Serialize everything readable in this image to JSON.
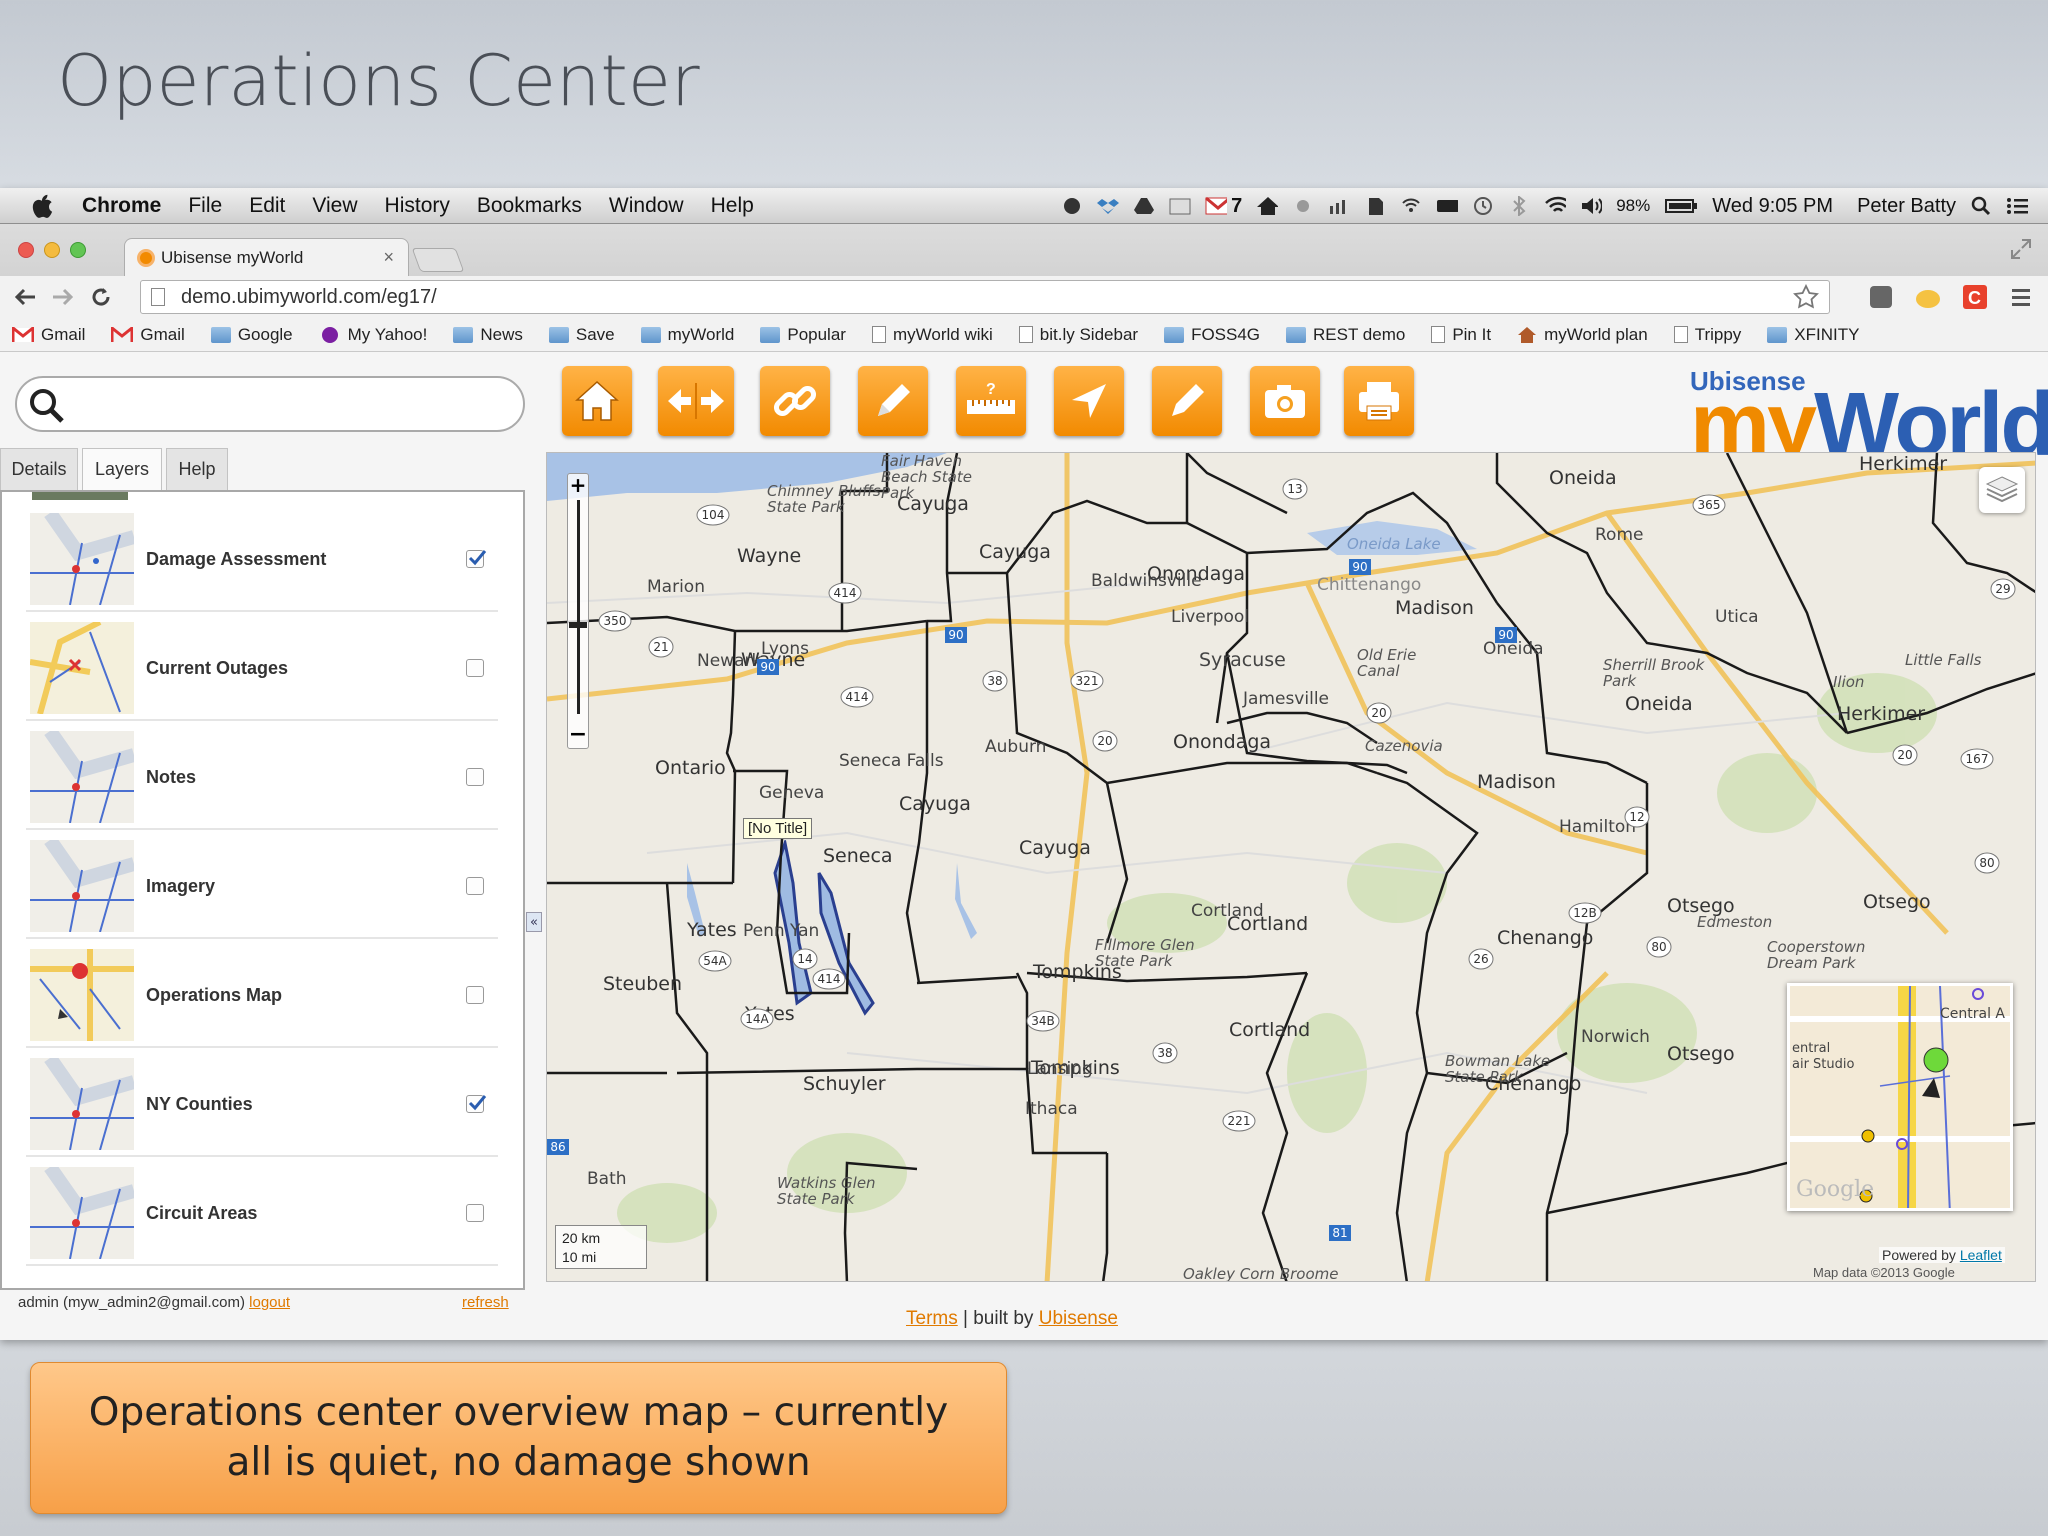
{
  "slide": {
    "title": "Operations Center",
    "caption": "Operations center overview map – currently all is quiet, no damage shown"
  },
  "menubar": {
    "app": "Chrome",
    "items": [
      "File",
      "Edit",
      "View",
      "History",
      "Bookmarks",
      "Window",
      "Help"
    ],
    "gmail_count": "7",
    "battery": "98%",
    "clock": "Wed 9:05 PM",
    "user": "Peter Batty"
  },
  "browser": {
    "tab_title": "Ubisense myWorld",
    "url": "demo.ubimyworld.com/eg17/",
    "bookmarks": [
      "Gmail",
      "Gmail",
      "Google",
      "My Yahoo!",
      "News",
      "Save",
      "myWorld",
      "Popular",
      "myWorld wiki",
      "bit.ly Sidebar",
      "FOSS4G",
      "REST demo",
      "Pin It",
      "myWorld plan",
      "Trippy",
      "XFINITY"
    ]
  },
  "app": {
    "logo_top": "Ubisense",
    "logo_main_my": "my",
    "logo_main_world": "World",
    "panel_tabs": [
      "Details",
      "Layers",
      "Help"
    ],
    "active_tab": "Layers",
    "layers": [
      {
        "name": "Damage Assessment",
        "checked": true
      },
      {
        "name": "Current Outages",
        "checked": false
      },
      {
        "name": "Notes",
        "checked": false
      },
      {
        "name": "Imagery",
        "checked": false
      },
      {
        "name": "Operations Map",
        "checked": false
      },
      {
        "name": "NY Counties",
        "checked": true
      },
      {
        "name": "Circuit Areas",
        "checked": false
      }
    ],
    "footer_user": "admin (myw_admin2@gmail.com)",
    "footer_logout": "logout",
    "footer_refresh": "refresh",
    "bottom_terms": "Terms",
    "bottom_built": "| built by",
    "bottom_company": "Ubisense"
  },
  "map": {
    "title_popup": "[No Title]",
    "scale_km": "20 km",
    "scale_mi": "10 mi",
    "powered_by": "Powered by",
    "leaflet": "Leaflet",
    "map_data": "Map data ©2013 Google",
    "counties": [
      "Cayuga",
      "Cayuga",
      "Cayuga",
      "Wayne",
      "Wayne",
      "Ontario",
      "Onondaga",
      "Onondaga",
      "Madison",
      "Madison",
      "Oneida",
      "Oneida",
      "Herkimer",
      "Herkimer",
      "Seneca",
      "Yates",
      "Yates",
      "Steuben",
      "Schuyler",
      "Tompkins",
      "Tompkins",
      "Cortland",
      "Cortland",
      "Chenango",
      "Chenango",
      "Otsego",
      "Otsego",
      "Otsego",
      "Cayuga"
    ],
    "places": [
      "Syracuse",
      "Utica",
      "Rome",
      "Auburn",
      "Seneca Falls",
      "Geneva",
      "Liverpool",
      "Baldwinsville",
      "Jamesville",
      "Hamilton",
      "Norwich",
      "Ithaca",
      "Lansing",
      "Cortland",
      "Oneida",
      "Chittenango",
      "Marion",
      "Lyons",
      "Newark",
      "Penn Yan",
      "Bath",
      "Watkins Glen State Park",
      "Chimney Bluffs State Park",
      "Fair Haven Beach State Park",
      "Fillmore Glen State Park",
      "Bowman Lake State Park",
      "Sherrill Brook Park",
      "Cooperstown Dream Park",
      "Little Falls",
      "Ilion",
      "Edmeston",
      "Cazenovia",
      "Oakley Corn Broome",
      "Old Erie Canal",
      "Oneida Lake"
    ]
  },
  "colors": {
    "accent_orange": "#f28a00",
    "logo_blue": "#3366bb",
    "logo_orange": "#f08a00",
    "county_border": "#1a1a1a",
    "highway": "#f3c35a"
  }
}
